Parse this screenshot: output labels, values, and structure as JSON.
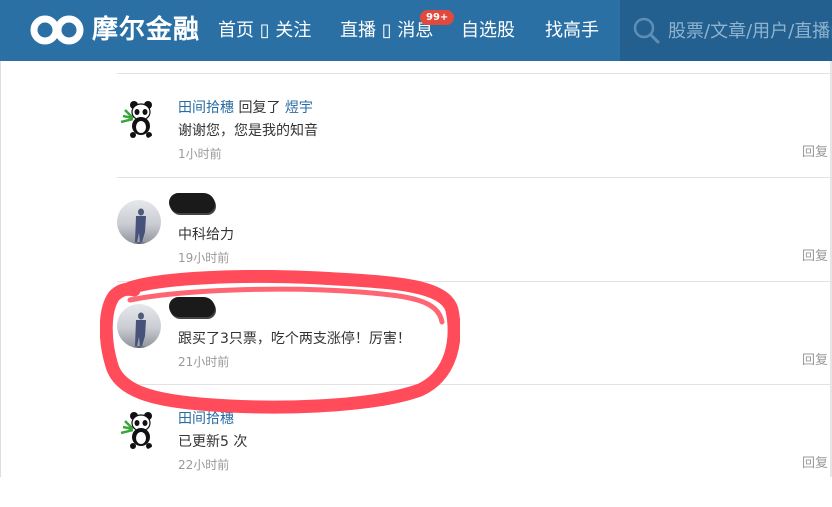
{
  "brand": {
    "name": "摩尔金融"
  },
  "nav": {
    "items": [
      {
        "label": "首页 ▯ 关注"
      },
      {
        "label": "直播 ▯ 消息"
      },
      {
        "label": "自选股"
      },
      {
        "label": "找高手"
      }
    ],
    "badge": "99+"
  },
  "search": {
    "placeholder": "股票/文章/用户/直播间"
  },
  "replies": [
    {
      "author": "田间拾穗",
      "action": "回复了",
      "target": "煜宇",
      "text": "谢谢您，您是我的知音",
      "time": "1小时前",
      "reply_label": "回复",
      "avatar": "panda-avatar-icon"
    },
    {
      "author": "",
      "text": "中科给力",
      "time": "19小时前",
      "reply_label": "回复",
      "avatar": "silhouette-avatar-icon"
    },
    {
      "author": "",
      "text": "跟买了3只票，吃个两支涨停！厉害！",
      "time": "21小时前",
      "reply_label": "回复",
      "avatar": "silhouette-avatar-icon"
    },
    {
      "author": "田间拾穗",
      "text": "已更新5 次",
      "time": "22小时前",
      "reply_label": "回复",
      "avatar": "panda-avatar-icon"
    }
  ],
  "colors": {
    "nav_bg": "#2a70a5",
    "search_bg": "#23608f",
    "badge": "#e0493c",
    "link": "#2a6da4",
    "highlight": "#ff4b5a"
  }
}
